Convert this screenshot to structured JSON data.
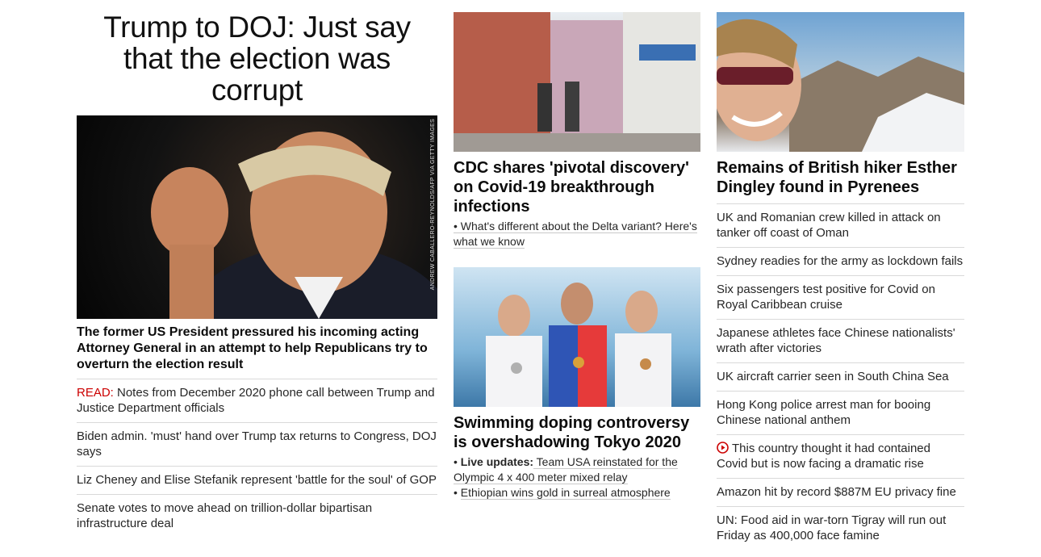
{
  "col1": {
    "banner": "Trump to DOJ: Just say that the election was corrupt",
    "photo_credit": "ANDREW CABALLERO-REYNOLDS/AFP VIA GETTY IMAGES",
    "lead": "The former US President pressured his incoming acting Attorney General in an attempt to help Republicans try to overturn the election result",
    "read_prefix": "READ:",
    "read_text": " Notes from December 2020 phone call between Trump and Justice Department officials",
    "items": [
      "Biden admin. 'must' hand over Trump tax returns to Congress, DOJ says",
      "Liz Cheney and Elise Stefanik represent 'battle for the soul' of GOP",
      "Senate votes to move ahead on trillion-dollar bipartisan infrastructure deal"
    ]
  },
  "col2": {
    "story1": {
      "headline": "CDC shares 'pivotal discovery' on Covid-19 breakthrough infections",
      "sub": "• What's different about the Delta variant? Here's what we know"
    },
    "story2": {
      "headline": "Swimming doping controversy is overshadowing Tokyo 2020",
      "sub1_bold": "Live updates:",
      "sub1_text": " Team USA reinstated for the Olympic 4 x 400 meter mixed relay",
      "sub2": "Ethiopian wins gold in surreal atmosphere"
    }
  },
  "col3": {
    "headline": "Remains of British hiker Esther Dingley found in Pyrenees",
    "items": [
      "UK and Romanian crew killed in attack on tanker off coast of Oman",
      "Sydney readies for the army as lockdown fails",
      "Six passengers test positive for Covid on Royal Caribbean cruise",
      "Japanese athletes face Chinese nationalists' wrath after victories",
      "UK aircraft carrier seen in South China Sea",
      "Hong Kong police arrest man for booing Chinese national anthem"
    ],
    "video_item": "This country thought it had contained Covid but is now facing a dramatic rise",
    "items2": [
      "Amazon hit by record $887M EU privacy fine",
      "UN: Food aid in war-torn Tigray will run out Friday as 400,000 face famine"
    ]
  },
  "colors": {
    "accent_red": "#cc0000",
    "divider": "#d9d9d9"
  }
}
